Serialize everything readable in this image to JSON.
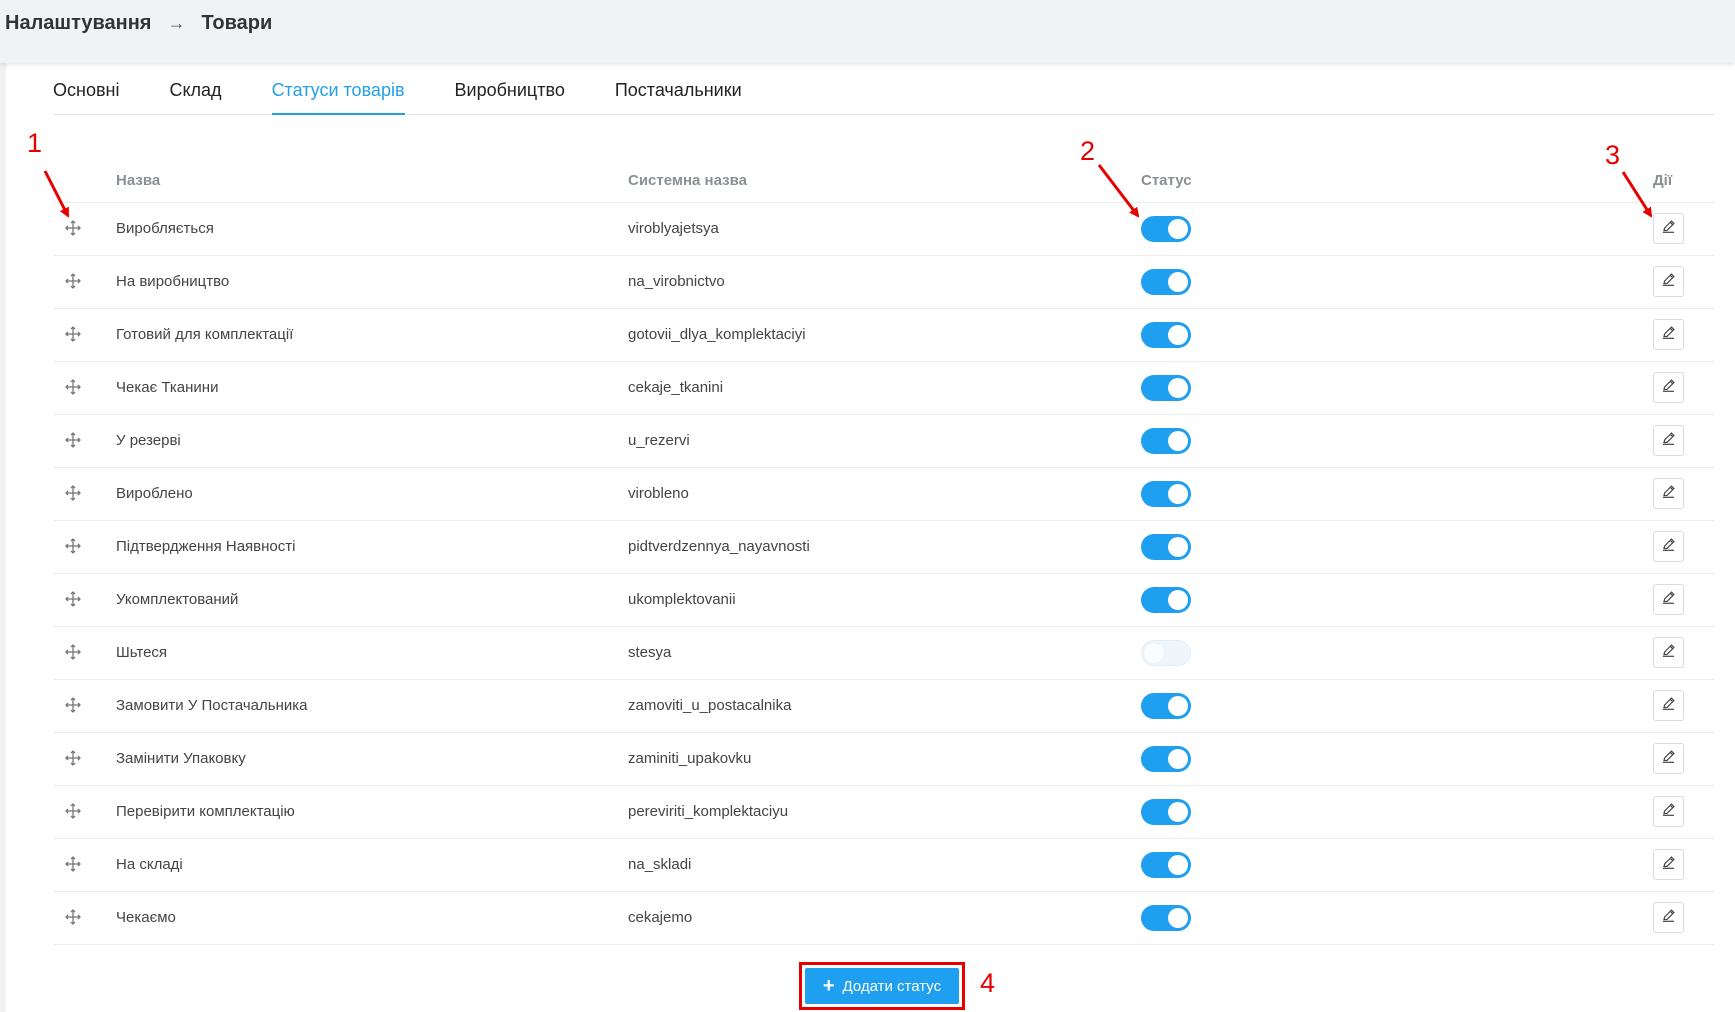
{
  "breadcrumb": {
    "parent": "Налаштування",
    "separator": "→",
    "current": "Товари"
  },
  "tabs": [
    {
      "label": "Основні",
      "active": false
    },
    {
      "label": "Склад",
      "active": false
    },
    {
      "label": "Статуси товарів",
      "active": true
    },
    {
      "label": "Виробництво",
      "active": false
    },
    {
      "label": "Постачальники",
      "active": false
    }
  ],
  "table": {
    "headers": {
      "name": "Назва",
      "system_name": "Системна назва",
      "status": "Статус",
      "actions": "Дії"
    },
    "rows": [
      {
        "name": "Виробляється",
        "system_name": "viroblyajetsya",
        "enabled": true
      },
      {
        "name": "На виробництво",
        "system_name": "na_virobnictvo",
        "enabled": true
      },
      {
        "name": "Готовий для комплектації",
        "system_name": "gotovii_dlya_komplektaciyi",
        "enabled": true
      },
      {
        "name": "Чекає Тканини",
        "system_name": "cekaje_tkanini",
        "enabled": true
      },
      {
        "name": "У резерві",
        "system_name": "u_rezervi",
        "enabled": true
      },
      {
        "name": "Вироблено",
        "system_name": "virobleno",
        "enabled": true
      },
      {
        "name": "Підтвердження Наявності",
        "system_name": "pidtverdzennya_nayavnosti",
        "enabled": true
      },
      {
        "name": "Укомплектований",
        "system_name": "ukomplektovanii",
        "enabled": true
      },
      {
        "name": "Шьтеся",
        "system_name": "stesya",
        "enabled": false
      },
      {
        "name": "Замовити У Постачальника",
        "system_name": "zamoviti_u_postacalnika",
        "enabled": true
      },
      {
        "name": "Замінити Упаковку",
        "system_name": "zaminiti_upakovku",
        "enabled": true
      },
      {
        "name": "Перевірити комплектацію",
        "system_name": "pereviriti_komplektaciyu",
        "enabled": true
      },
      {
        "name": "На складі",
        "system_name": "na_skladi",
        "enabled": true
      },
      {
        "name": "Чекаємо",
        "system_name": "cekajemo",
        "enabled": true
      }
    ]
  },
  "add_button": {
    "label": "Додати статус"
  },
  "annotations": [
    "1",
    "2",
    "3",
    "4"
  ],
  "colors": {
    "accent": "#1e9ff0",
    "annotation": "#e60000",
    "topbar": "#f1f2f4"
  },
  "icons": {
    "drag": "move-arrows-icon",
    "edit": "pencil-icon",
    "add": "plus-icon"
  }
}
